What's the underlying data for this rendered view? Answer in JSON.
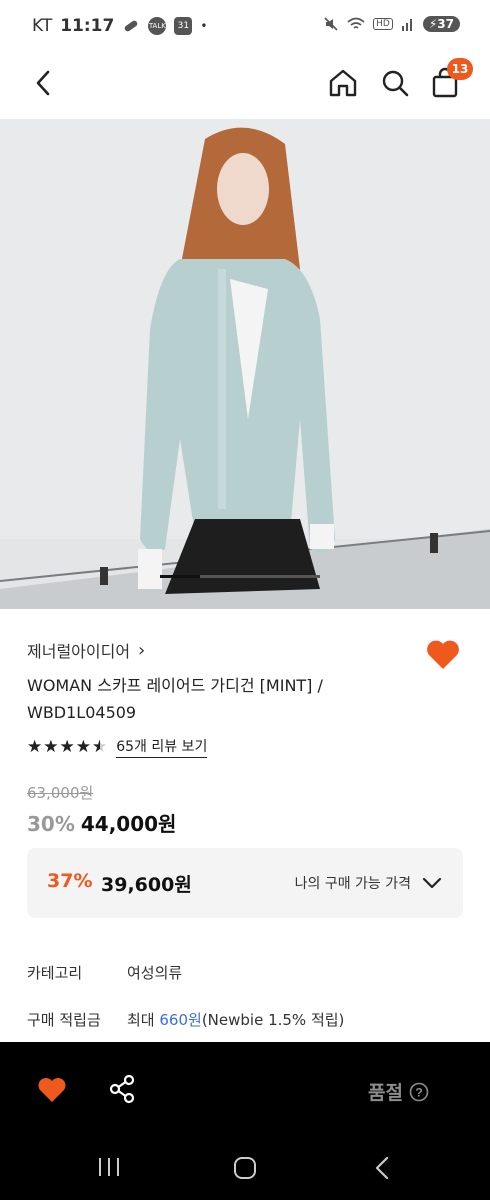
{
  "status_bar": {
    "carrier": "KT",
    "time": "11:17",
    "icons": [
      "link-icon",
      "talk-icon",
      "calendar-icon"
    ],
    "talk_label": "TALK",
    "calendar_label": "31",
    "dot": "•",
    "right_icons": [
      "mute-icon",
      "wifi-icon",
      "hd-icon",
      "signal-icon"
    ],
    "hd_label": "HD",
    "battery": "37"
  },
  "nav": {
    "icons": [
      "back-icon",
      "home-icon",
      "search-icon",
      "shopping-bag-icon"
    ],
    "bag_count": "13"
  },
  "product": {
    "brand": "제너럴아이디어",
    "brand_arrow": "›",
    "name": "WOMAN 스카프 레이어드 가디건 [MINT] / WBD1L04509",
    "stars": "★★★★★",
    "review_link": "65개 리뷰 보기",
    "rating_fraction": 0.9,
    "original_price": "63,000원",
    "discount": "30%",
    "price": "44,000원",
    "favorite_color": "#f0591e"
  },
  "my_price": {
    "discount": "37%",
    "price": "39,600원",
    "label": "나의 구매 가능 가격"
  },
  "details": {
    "category_key": "카테고리",
    "category_value": "여성의류",
    "points_key": "구매 적립금",
    "points_prefix": "최대 ",
    "points_amount": "660원",
    "points_suffix": "(Newbie 1.5% 적립)"
  },
  "bottom_bar": {
    "soldout_label": "품절",
    "icons": [
      "heart-icon",
      "share-icon",
      "help-icon"
    ]
  },
  "system_nav": {
    "icons": [
      "recent-apps-icon",
      "home-circle-icon",
      "back-chevron-icon"
    ]
  },
  "colors": {
    "accent": "#f0591e",
    "link_blue": "#3a6fd8",
    "bottom_bar": "#000000"
  }
}
